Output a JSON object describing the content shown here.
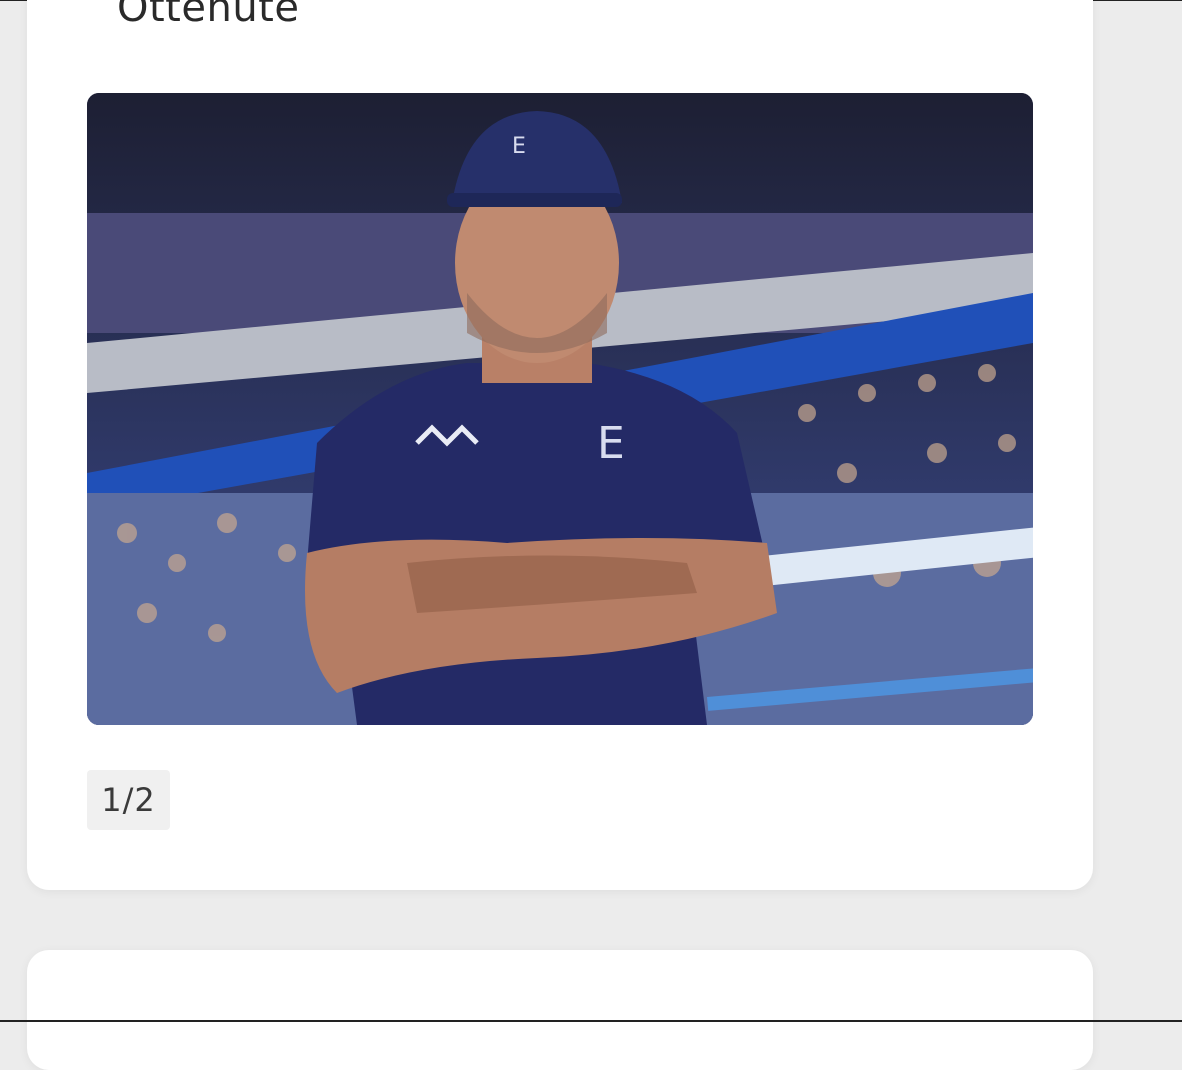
{
  "article": {
    "heading_fragment": "Ottenute",
    "gallery": {
      "image_alt": "Empoli coach standing with arms crossed in stadium",
      "counter": "1/2"
    }
  },
  "colors": {
    "page_background": "#ececec",
    "card_background": "#ffffff",
    "counter_background": "#f0f0f0"
  }
}
